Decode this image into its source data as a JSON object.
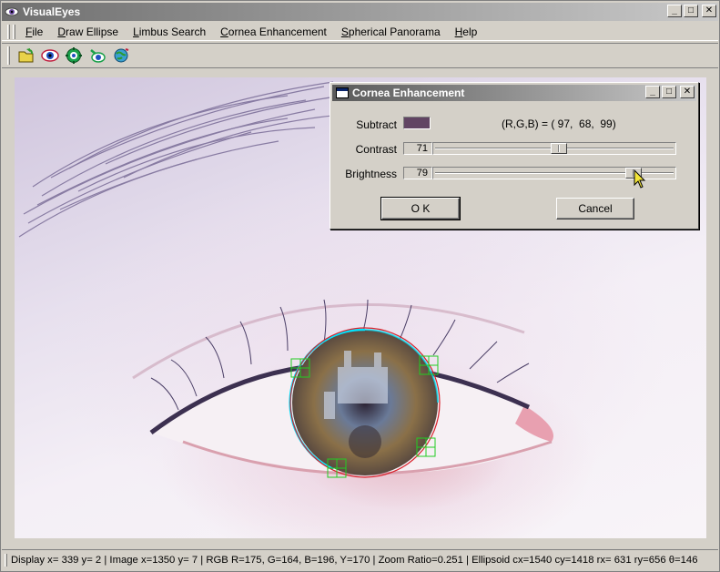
{
  "window": {
    "title": "VisualEyes"
  },
  "menu": [
    {
      "label": "File",
      "accel": "F",
      "rest": "ile"
    },
    {
      "label": "Draw Ellipse",
      "accel": "D",
      "rest": "raw Ellipse"
    },
    {
      "label": "Limbus Search",
      "accel": "L",
      "rest": "imbus Search"
    },
    {
      "label": "Cornea Enhancement",
      "accel": "C",
      "rest": "ornea Enhancement"
    },
    {
      "label": "Spherical Panorama",
      "accel": "S",
      "rest": "pherical Panorama"
    },
    {
      "label": "Help",
      "accel": "H",
      "rest": "elp"
    }
  ],
  "toolbar": [
    "open-folder-icon",
    "eye-icon",
    "gear-eye-icon",
    "eye-search-icon",
    "globe-icon"
  ],
  "dialog": {
    "title": "Cornea Enhancement",
    "subtract_label": "Subtract",
    "subtract_color": "#614463",
    "rgb_text": "(R,G,B) = ( 97,  68,  99)",
    "contrast_label": "Contrast",
    "contrast_value": "71",
    "contrast_level": 0.52,
    "brightness_label": "Brightness",
    "brightness_value": "79",
    "brightness_level": 0.85,
    "ok_label": "O K",
    "cancel_label": "Cancel"
  },
  "status": "Display x= 339 y=   2 | Image x=1350 y=   7 | RGB R=175, G=164, B=196, Y=170 | Zoom Ratio=0.251 | Ellipsoid cx=1540 cy=1418 rx= 631 ry=656 θ=146",
  "colors": {
    "limbus_red": "#d8202a",
    "limbus_cyan": "#00e5ff",
    "marker_green": "#22cc22"
  }
}
